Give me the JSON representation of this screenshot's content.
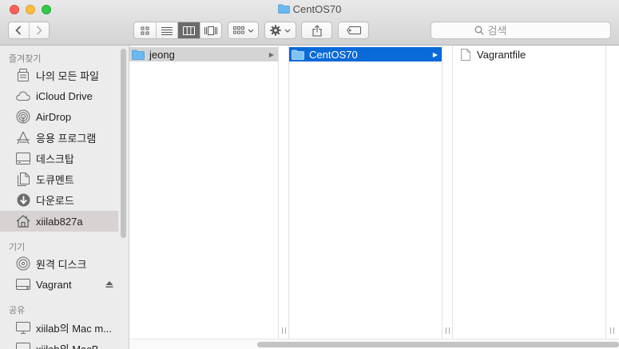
{
  "window": {
    "title": "CentOS70"
  },
  "toolbar": {
    "search_placeholder": "검색",
    "views": [
      "icon-view",
      "list-view",
      "column-view",
      "cover-flow-view"
    ],
    "active_view": "column-view"
  },
  "sidebar": {
    "sections": [
      {
        "header": "즐겨찾기",
        "items": [
          {
            "label": "나의 모든 파일",
            "icon": "all-files-icon"
          },
          {
            "label": "iCloud Drive",
            "icon": "cloud-icon"
          },
          {
            "label": "AirDrop",
            "icon": "airdrop-icon"
          },
          {
            "label": "응용 프로그램",
            "icon": "applications-icon"
          },
          {
            "label": "데스크탑",
            "icon": "desktop-icon"
          },
          {
            "label": "도큐멘트",
            "icon": "documents-icon"
          },
          {
            "label": "다운로드",
            "icon": "downloads-icon"
          },
          {
            "label": "xiilab827a",
            "icon": "home-icon",
            "selected": true
          }
        ]
      },
      {
        "header": "기기",
        "items": [
          {
            "label": "원격 디스크",
            "icon": "remote-disc-icon"
          },
          {
            "label": "Vagrant",
            "icon": "drive-icon",
            "eject": true
          }
        ]
      },
      {
        "header": "공유",
        "items": [
          {
            "label": "xiilab의 Mac m...",
            "icon": "computer-icon"
          },
          {
            "label": "xiilab의 MacB...",
            "icon": "computer-icon"
          }
        ]
      }
    ]
  },
  "columns": [
    {
      "items": [
        {
          "name": "jeong",
          "kind": "folder",
          "selected": "inactive",
          "has_children": true
        }
      ]
    },
    {
      "items": [
        {
          "name": "CentOS70",
          "kind": "folder",
          "selected": "active",
          "has_children": true
        }
      ]
    },
    {
      "items": [
        {
          "name": "Vagrantfile",
          "kind": "file"
        }
      ]
    }
  ],
  "colors": {
    "selection_active": "#0a6ad8",
    "selection_inactive": "#d4d4d4",
    "folder": "#6bb7f0",
    "sidebar_bg": "#ececec"
  }
}
